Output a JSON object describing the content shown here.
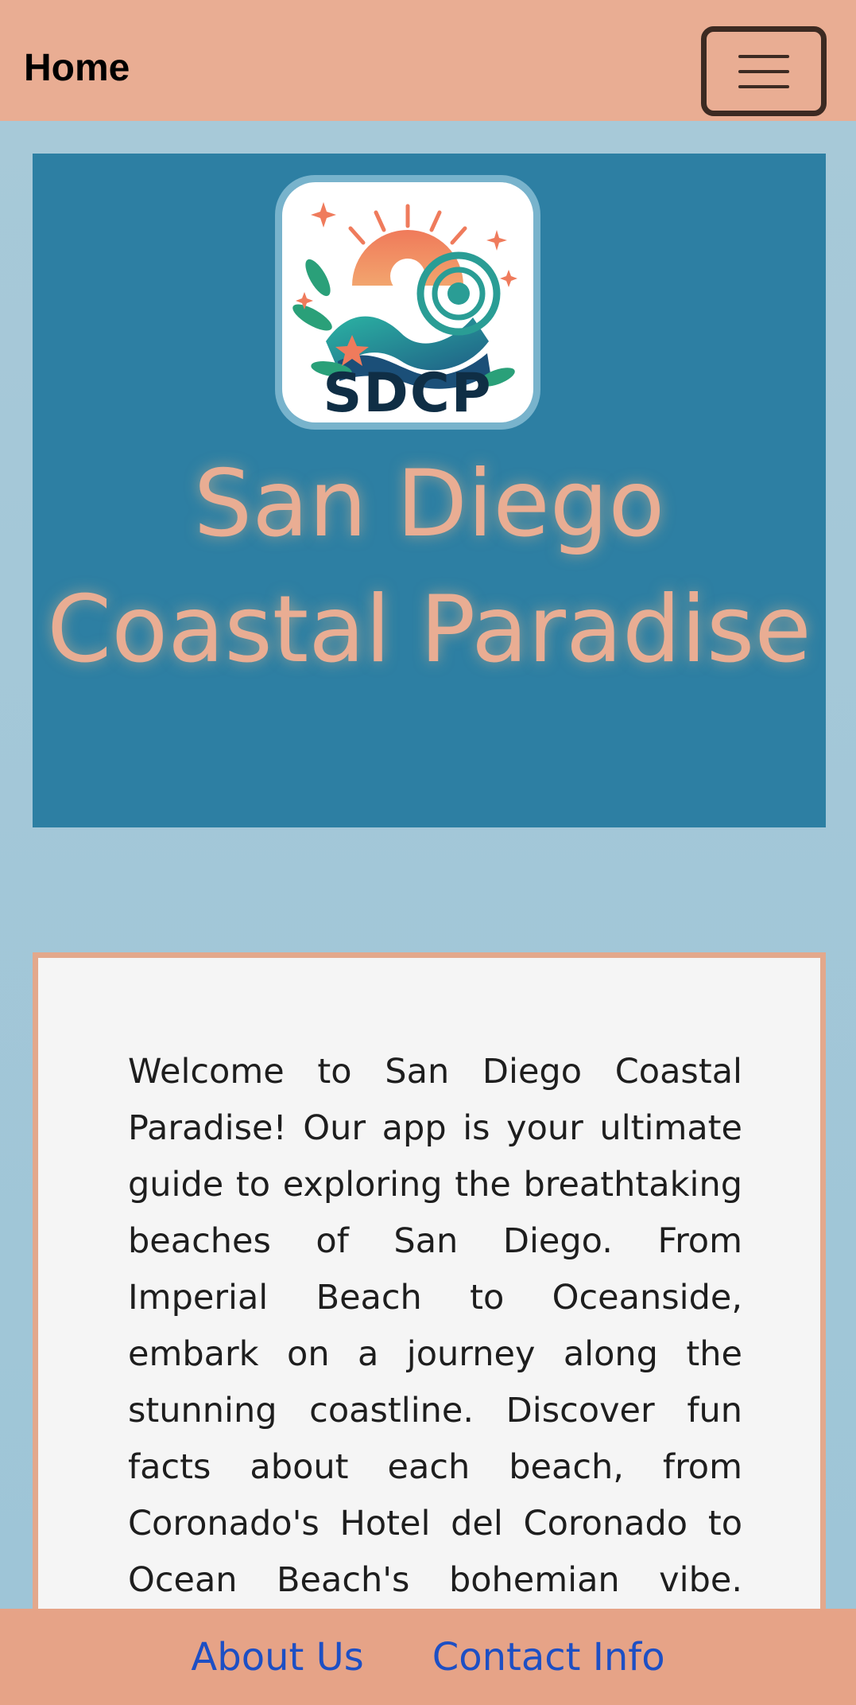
{
  "header": {
    "title": "Home",
    "menu_icon": "hamburger-menu-icon"
  },
  "hero": {
    "logo_text": "SDCP",
    "title": "San Diego Coastal Paradise"
  },
  "intro": {
    "text": "Welcome to San Diego Coastal Paradise! Our app is your ultimate guide to exploring the breathtaking beaches of San Diego. From Imperial Beach to Oceanside, embark on a journey along the stunning coastline. Discover fun facts about each beach, from Coronado's Hotel del Coronado to Ocean Beach's bohemian vibe. Immerse yourself in"
  },
  "footer": {
    "links": [
      {
        "label": "About Us"
      },
      {
        "label": "Contact Info"
      }
    ]
  },
  "colors": {
    "header_bg": "#e9ad93",
    "page_bg": "#a7c9d8",
    "hero_bg": "#2d7fa3",
    "title_color": "#e9ad93",
    "link_color": "#1d4fc4"
  }
}
